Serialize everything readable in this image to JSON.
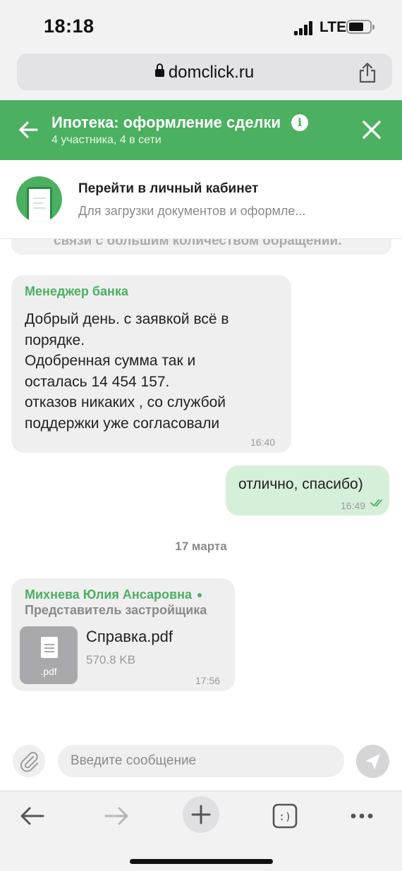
{
  "status_bar": {
    "time": "18:18",
    "network": "LTE"
  },
  "browser": {
    "url": "domclick.ru"
  },
  "header": {
    "title": "Ипотека: оформление сделки",
    "subtitle": "4 участника, 4 в сети"
  },
  "cabinet": {
    "title": "Перейти в личный кабинет",
    "subtitle": "Для загрузки документов и оформле..."
  },
  "chat": {
    "partial_text": "связи с большим количеством обращений.",
    "messages": [
      {
        "sender": "Менеджер банка",
        "text": "Добрый день. с заявкой всё в\nпорядке.\nОдобренная сумма так и\nосталась 14 454 157.\nотказов никаких , со службой\nподдержки уже согласовали",
        "time": "16:40"
      },
      {
        "text": "отлично, спасибо)",
        "time": "16:49"
      }
    ],
    "date_divider": "17 марта",
    "file_message": {
      "sender": "Михнева Юлия Ансаровна",
      "role": "Представитель застройщика",
      "file_ext": ".pdf",
      "file_name": "Справка.pdf",
      "file_size": "570.8 KB",
      "time": "17:56"
    }
  },
  "composer": {
    "placeholder": "Введите сообщение"
  },
  "colors": {
    "brand_green": "#4bb060",
    "outgoing_bubble": "#d6efd9",
    "incoming_bubble": "#efeff0"
  }
}
